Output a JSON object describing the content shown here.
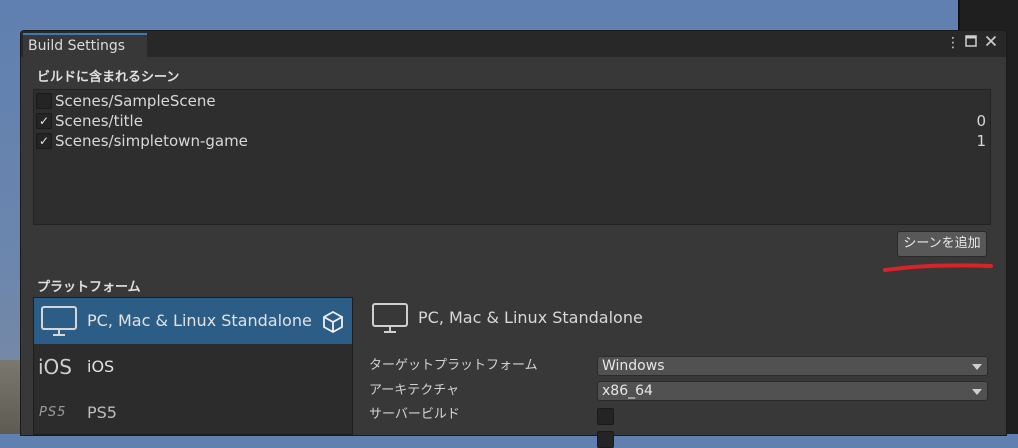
{
  "window": {
    "title": "Build Settings",
    "menu_icon": "kebab-menu-icon",
    "maximize_icon": "maximize-icon",
    "close_icon": "close-icon"
  },
  "scenes": {
    "header": "ビルドに含まれるシーン",
    "items": [
      {
        "name": "Scenes/SampleScene",
        "checked": false,
        "index": ""
      },
      {
        "name": "Scenes/title",
        "checked": true,
        "index": "0"
      },
      {
        "name": "Scenes/simpletown-game",
        "checked": true,
        "index": "1"
      }
    ],
    "add_button": "シーンを追加",
    "annotation_color": "#d9232a"
  },
  "platforms": {
    "header": "プラットフォーム",
    "items": [
      {
        "label": "PC, Mac & Linux Standalone",
        "icon": "monitor-icon",
        "selected": true,
        "active_badge": "unity-icon"
      },
      {
        "label": "iOS",
        "icon": "ios-icon",
        "selected": false
      },
      {
        "label": "PS5",
        "icon": "ps5-icon",
        "selected": false
      }
    ]
  },
  "details": {
    "title": "PC, Mac & Linux Standalone",
    "icon": "monitor-icon",
    "target_platform_label": "ターゲットプラットフォーム",
    "target_platform_value": "Windows",
    "architecture_label": "アーキテクチャ",
    "architecture_value": "x86_64",
    "server_build_label": "サーバービルド",
    "server_build_checked": false
  },
  "colors": {
    "selection": "#2c5d87",
    "tab_accent": "#3a79bb",
    "window_bg": "#383838"
  }
}
